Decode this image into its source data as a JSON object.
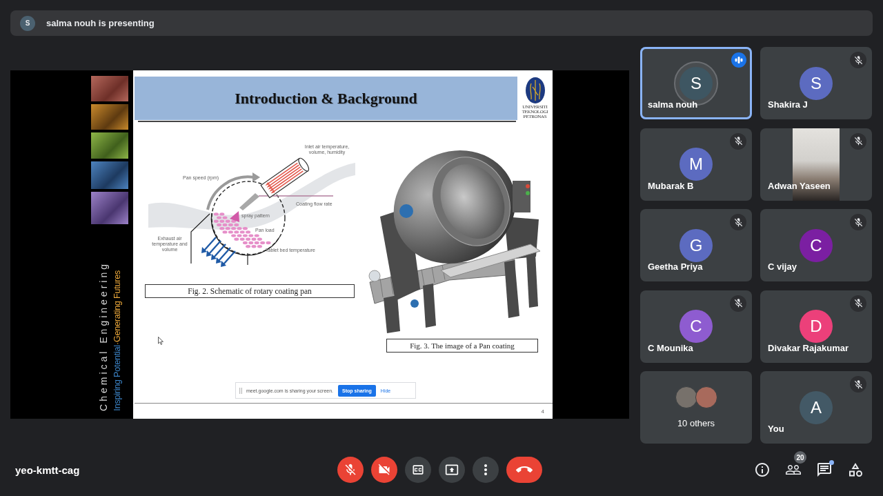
{
  "presenter_banner": {
    "initial": "S",
    "text": "salma nouh is presenting"
  },
  "slide": {
    "sidebar_heading": "Chemical Engineering",
    "sidebar_tagline": [
      {
        "text": "Inspiring Potential",
        "color": "#3b82c4"
      },
      {
        "text": "·Generating Futures",
        "color": "#e9a63a"
      }
    ],
    "title": "Introduction & Background",
    "logo_text": "UNIVERSITI TEKNOLOGI PETRONAS",
    "schematic": {
      "labels": [
        "Inlet air temperature, volume, humidity",
        "Pan speed (rpm)",
        "Coating flow rate",
        "spray pattern",
        "Pan load",
        "Exhaust air temperature and volume",
        "Tablet bed temperature"
      ],
      "caption": "Fig. 2. Schematic of rotary coating pan"
    },
    "photo_figure": {
      "caption": "Fig. 3. The image of a Pan coating"
    },
    "page_number": "4"
  },
  "share_notice": {
    "text": "meet.google.com is sharing your screen.",
    "stop_button": "Stop sharing",
    "hide_link": "Hide"
  },
  "participants": [
    {
      "kind": "avatar",
      "name": "salma nouh",
      "initial": "S",
      "color": "#3e5662",
      "muted": false,
      "speaking": true
    },
    {
      "kind": "avatar",
      "name": "Shakira J",
      "initial": "S",
      "color": "#5c6bc0",
      "muted": true,
      "speaking": false
    },
    {
      "kind": "avatar",
      "name": "Mubarak B",
      "initial": "M",
      "color": "#5c6bc0",
      "muted": true,
      "speaking": false
    },
    {
      "kind": "video",
      "name": "Adwan Yaseen",
      "muted": true,
      "speaking": false
    },
    {
      "kind": "avatar",
      "name": "Geetha Priya",
      "initial": "G",
      "color": "#5c6bc0",
      "muted": true,
      "speaking": false
    },
    {
      "kind": "avatar",
      "name": "C vijay",
      "initial": "C",
      "color": "#7b1fa2",
      "muted": true,
      "speaking": false
    },
    {
      "kind": "avatar",
      "name": "C Mounika",
      "initial": "C",
      "color": "#8e5cd0",
      "muted": true,
      "speaking": false
    },
    {
      "kind": "avatar",
      "name": "Divakar Rajakumar",
      "initial": "D",
      "color": "#ec407a",
      "muted": true,
      "speaking": false
    },
    {
      "kind": "others",
      "label": "10 others"
    },
    {
      "kind": "avatar",
      "name": "You",
      "initial": "A",
      "color": "#435966",
      "muted": true,
      "speaking": false
    }
  ],
  "meeting_code": "yeo-kmtt-cag",
  "call_controls": [
    {
      "kind": "mic",
      "on": false
    },
    {
      "kind": "camera",
      "on": false
    },
    {
      "kind": "captions",
      "on": false
    },
    {
      "kind": "present"
    },
    {
      "kind": "more"
    },
    {
      "kind": "end_call"
    }
  ],
  "side_actions": [
    {
      "kind": "info"
    },
    {
      "kind": "people",
      "badge": "20"
    },
    {
      "kind": "chat",
      "unread": true
    },
    {
      "kind": "activities"
    }
  ]
}
